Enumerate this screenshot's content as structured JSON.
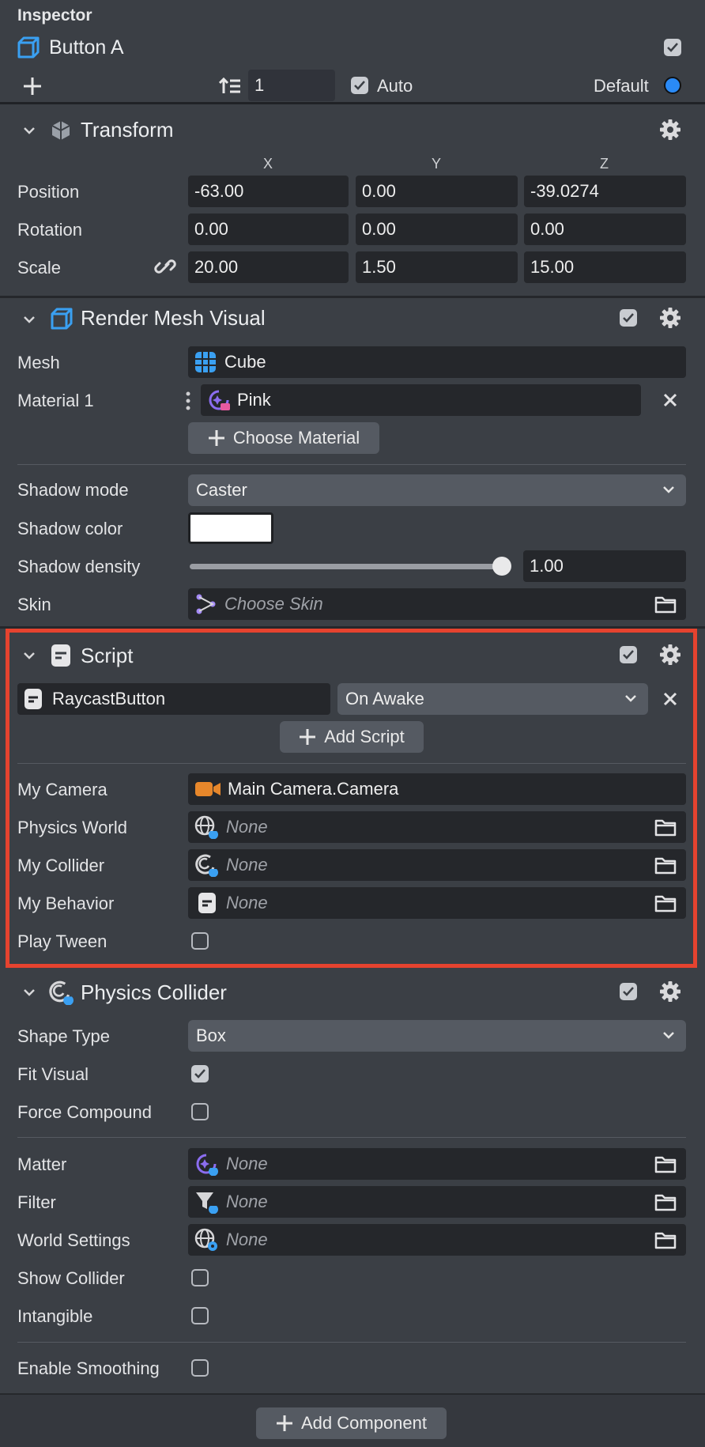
{
  "inspector": {
    "title": "Inspector",
    "object_name": "Button A",
    "layer_value": "1",
    "auto_label": "Auto",
    "default_label": "Default"
  },
  "transform": {
    "title": "Transform",
    "axis_x": "X",
    "axis_y": "Y",
    "axis_z": "Z",
    "position_label": "Position",
    "rotation_label": "Rotation",
    "scale_label": "Scale",
    "position": [
      "-63.00",
      "0.00",
      "-39.0274"
    ],
    "rotation": [
      "0.00",
      "0.00",
      "0.00"
    ],
    "scale": [
      "20.00",
      "1.50",
      "15.00"
    ]
  },
  "render_mesh": {
    "title": "Render Mesh Visual",
    "mesh_label": "Mesh",
    "mesh_value": "Cube",
    "material_label": "Material 1",
    "material_value": "Pink",
    "choose_material": "Choose Material",
    "shadow_mode_label": "Shadow mode",
    "shadow_mode_value": "Caster",
    "shadow_color_label": "Shadow color",
    "shadow_color_value": "#ffffff",
    "shadow_density_label": "Shadow density",
    "shadow_density_value": "1.00",
    "shadow_density_fraction": 1.0,
    "skin_label": "Skin",
    "skin_placeholder": "Choose Skin"
  },
  "script": {
    "title": "Script",
    "script_name": "RaycastButton",
    "event_value": "On Awake",
    "add_script": "Add Script",
    "camera_label": "My Camera",
    "camera_value": "Main Camera.Camera",
    "physics_world_label": "Physics World",
    "physics_world_value": "None",
    "collider_label": "My Collider",
    "collider_value": "None",
    "behavior_label": "My Behavior",
    "behavior_value": "None",
    "play_tween_label": "Play Tween",
    "highlight_color": "#e5432f"
  },
  "physics_collider": {
    "title": "Physics Collider",
    "shape_type_label": "Shape Type",
    "shape_type_value": "Box",
    "fit_visual_label": "Fit Visual",
    "force_compound_label": "Force Compound",
    "matter_label": "Matter",
    "matter_value": "None",
    "filter_label": "Filter",
    "filter_value": "None",
    "world_settings_label": "World Settings",
    "world_settings_value": "None",
    "show_collider_label": "Show Collider",
    "intangible_label": "Intangible",
    "enable_smoothing_label": "Enable Smoothing"
  },
  "footer": {
    "add_component": "Add Component"
  },
  "colors": {
    "accent_blue": "#2a8af6",
    "icon_blue": "#3aa0f2",
    "camera_orange": "#e7872b",
    "material_purple": "#8b6df0"
  }
}
